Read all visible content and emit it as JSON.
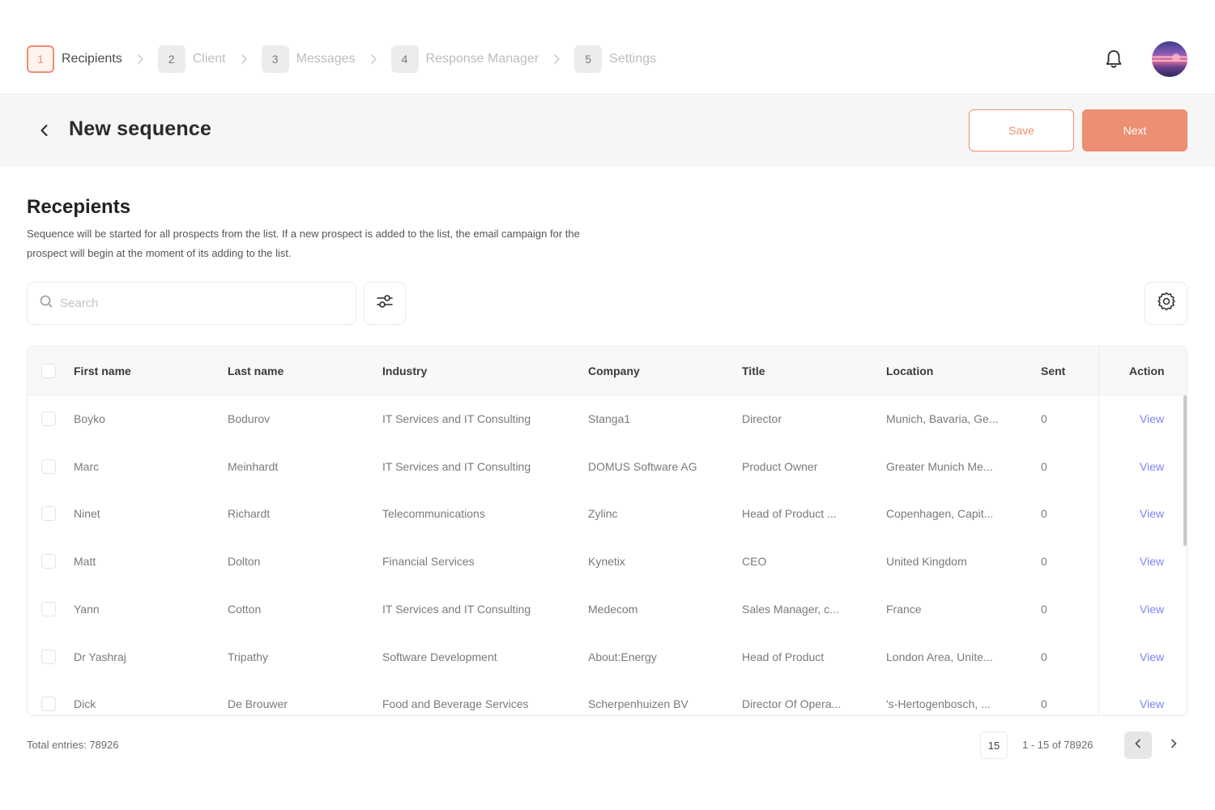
{
  "stepper": {
    "steps": [
      {
        "num": "1",
        "label": "Recipients",
        "active": true
      },
      {
        "num": "2",
        "label": "Client",
        "active": false
      },
      {
        "num": "3",
        "label": "Messages",
        "active": false
      },
      {
        "num": "4",
        "label": "Response Manager",
        "active": false
      },
      {
        "num": "5",
        "label": "Settings",
        "active": false
      }
    ]
  },
  "header": {
    "bell_icon": "bell-icon",
    "avatar_icon": "user-avatar"
  },
  "titlebar": {
    "title": "New sequence",
    "save_label": "Save",
    "next_label": "Next"
  },
  "section": {
    "title": "Recepients",
    "description": "Sequence will be started for all prospects from the list. If a new prospect is added to the list, the email campaign for the prospect will begin at the moment of its adding to the list."
  },
  "toolbar": {
    "search_placeholder": "Search",
    "search_value": "",
    "filter_icon": "sliders-icon",
    "settings_icon": "gear-icon"
  },
  "table": {
    "columns": [
      "First name",
      "Last name",
      "Industry",
      "Company",
      "Title",
      "Location",
      "Sent",
      "Action"
    ],
    "rows": [
      {
        "first": "Boyko",
        "last": "Bodurov",
        "industry": "IT Services and IT Consulting",
        "company": "Stanga1",
        "title": "Director",
        "location": "Munich, Bavaria, Ge...",
        "sent": "0",
        "action": "View"
      },
      {
        "first": "Marc",
        "last": "Meinhardt",
        "industry": "IT Services and IT Consulting",
        "company": "DOMUS Software AG",
        "title": "Product Owner",
        "location": "Greater Munich Me...",
        "sent": "0",
        "action": "View"
      },
      {
        "first": "Ninet",
        "last": "Richardt",
        "industry": "Telecommunications",
        "company": "Zylinc",
        "title": "Head of Product ...",
        "location": "Copenhagen, Capit...",
        "sent": "0",
        "action": "View"
      },
      {
        "first": "Matt",
        "last": "Dolton",
        "industry": "Financial Services",
        "company": "Kynetix",
        "title": "CEO",
        "location": "United Kingdom",
        "sent": "0",
        "action": "View"
      },
      {
        "first": "Yann",
        "last": "Cotton",
        "industry": "IT Services and IT Consulting",
        "company": "Medecom",
        "title": "Sales Manager, c...",
        "location": "France",
        "sent": "0",
        "action": "View"
      },
      {
        "first": "Dr Yashraj",
        "last": "Tripathy",
        "industry": "Software Development",
        "company": "About:Energy",
        "title": "Head of Product",
        "location": "London Area, Unite...",
        "sent": "0",
        "action": "View"
      },
      {
        "first": "Dick",
        "last": "De Brouwer",
        "industry": "Food and Beverage Services",
        "company": "Scherpenhuizen BV",
        "title": "Director Of Opera...",
        "location": "'s-Hertogenbosch, ...",
        "sent": "0",
        "action": "View"
      }
    ]
  },
  "footer": {
    "total_label": "Total entries: 78926",
    "page_size": "15",
    "range_label": "1 - 15 of 78926"
  },
  "colors": {
    "accent": "#ec8f73",
    "link": "#7b84f0",
    "muted": "#bdbdbd"
  }
}
